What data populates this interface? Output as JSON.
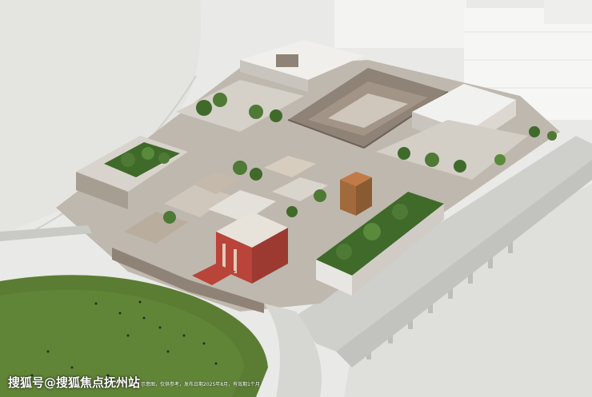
{
  "image": {
    "subject": "aerial-rendering-commercial-complex",
    "colors": {
      "sky_ground": "#e9e9e7",
      "paving": "#dcdcd8",
      "lawn": "#5b7d33",
      "lawn_light": "#7a9a45",
      "roof_dark": "#8f8276",
      "roof_light": "#cfc7bb",
      "timber": "#a06a3c",
      "red_accent": "#b8443a",
      "greenery": "#3f6a2a",
      "white_block": "#f1f1ef",
      "structure_grey": "#bdbdba"
    }
  },
  "watermark": {
    "text": "搜狐号@搜狐焦点抚州站",
    "caption": "示意图，仅供参考，发布日期2025年8月，有效期1个月"
  }
}
